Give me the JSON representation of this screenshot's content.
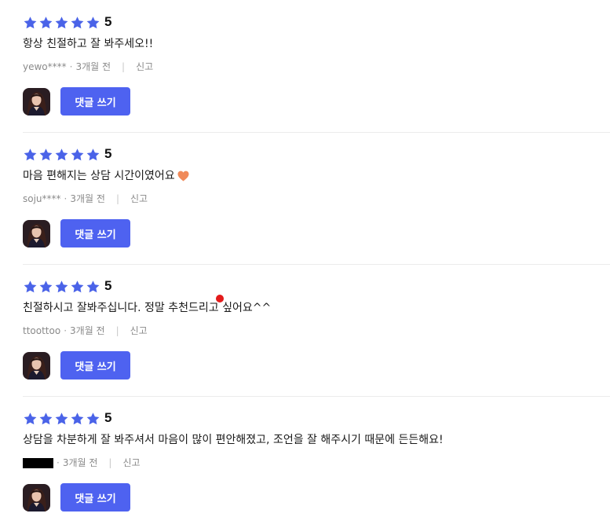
{
  "star_color": "#4a63e8",
  "button_color": "#4e62f0",
  "reviews": [
    {
      "rating": "5",
      "text": "항상 친절하고 잘 봐주세오!!",
      "user": "yewo****",
      "time": "3개월 전",
      "report": "신고",
      "reply_label": "댓글 쓰기",
      "icon": ""
    },
    {
      "rating": "5",
      "text": "마음 편해지는 상담 시간이였어요",
      "user": "soju****",
      "time": "3개월 전",
      "report": "신고",
      "reply_label": "댓글 쓰기",
      "icon": "orange-heart-emoji"
    },
    {
      "rating": "5",
      "text": "친절하시고 잘봐주십니다. 정말 추천드리고 싶어요^^",
      "user": "ttoottoo",
      "time": "3개월 전",
      "report": "신고",
      "reply_label": "댓글 쓰기",
      "icon": ""
    },
    {
      "rating": "5",
      "text": "상담을 차분하게 잘 봐주셔서 마음이 많이 편안해졌고, 조언을 잘 해주시기 때문에 든든해요!",
      "user": "",
      "user_masked": true,
      "time": "3개월 전",
      "report": "신고",
      "reply_label": "댓글 쓰기",
      "icon": ""
    }
  ]
}
